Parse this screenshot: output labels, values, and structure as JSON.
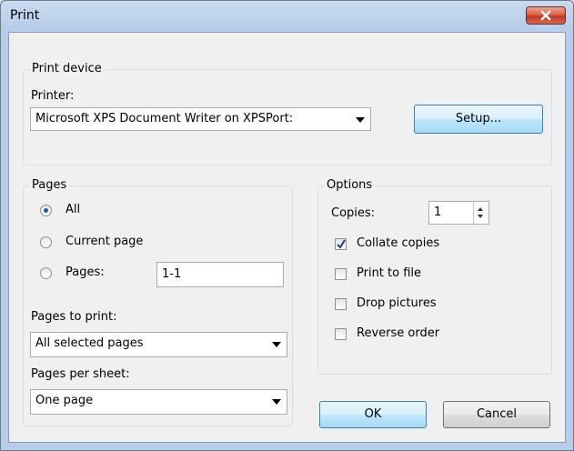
{
  "window": {
    "title": "Print"
  },
  "print_device": {
    "legend": "Print device",
    "printer_label": "Printer:",
    "printer_value": "Microsoft XPS Document Writer on XPSPort:",
    "setup_button": "Setup..."
  },
  "pages": {
    "legend": "Pages",
    "radio_all": "All",
    "radio_current": "Current page",
    "radio_pages": "Pages:",
    "pages_range_value": "1-1",
    "selected_radio": "All",
    "pages_to_print_label": "Pages to print:",
    "pages_to_print_value": "All selected pages",
    "pages_per_sheet_label": "Pages per sheet:",
    "pages_per_sheet_value": "One page"
  },
  "options": {
    "legend": "Options",
    "copies_label": "Copies:",
    "copies_value": "1",
    "collate_label": "Collate copies",
    "collate_checked": true,
    "print_to_file_label": "Print to file",
    "print_to_file_checked": false,
    "drop_pictures_label": "Drop pictures",
    "drop_pictures_checked": false,
    "reverse_order_label": "Reverse order",
    "reverse_order_checked": false
  },
  "buttons": {
    "ok": "OK",
    "cancel": "Cancel"
  },
  "colors": {
    "close_button": "#c94a32",
    "focus_button": "#bee6fd",
    "title_bar": "#b7cde9"
  }
}
